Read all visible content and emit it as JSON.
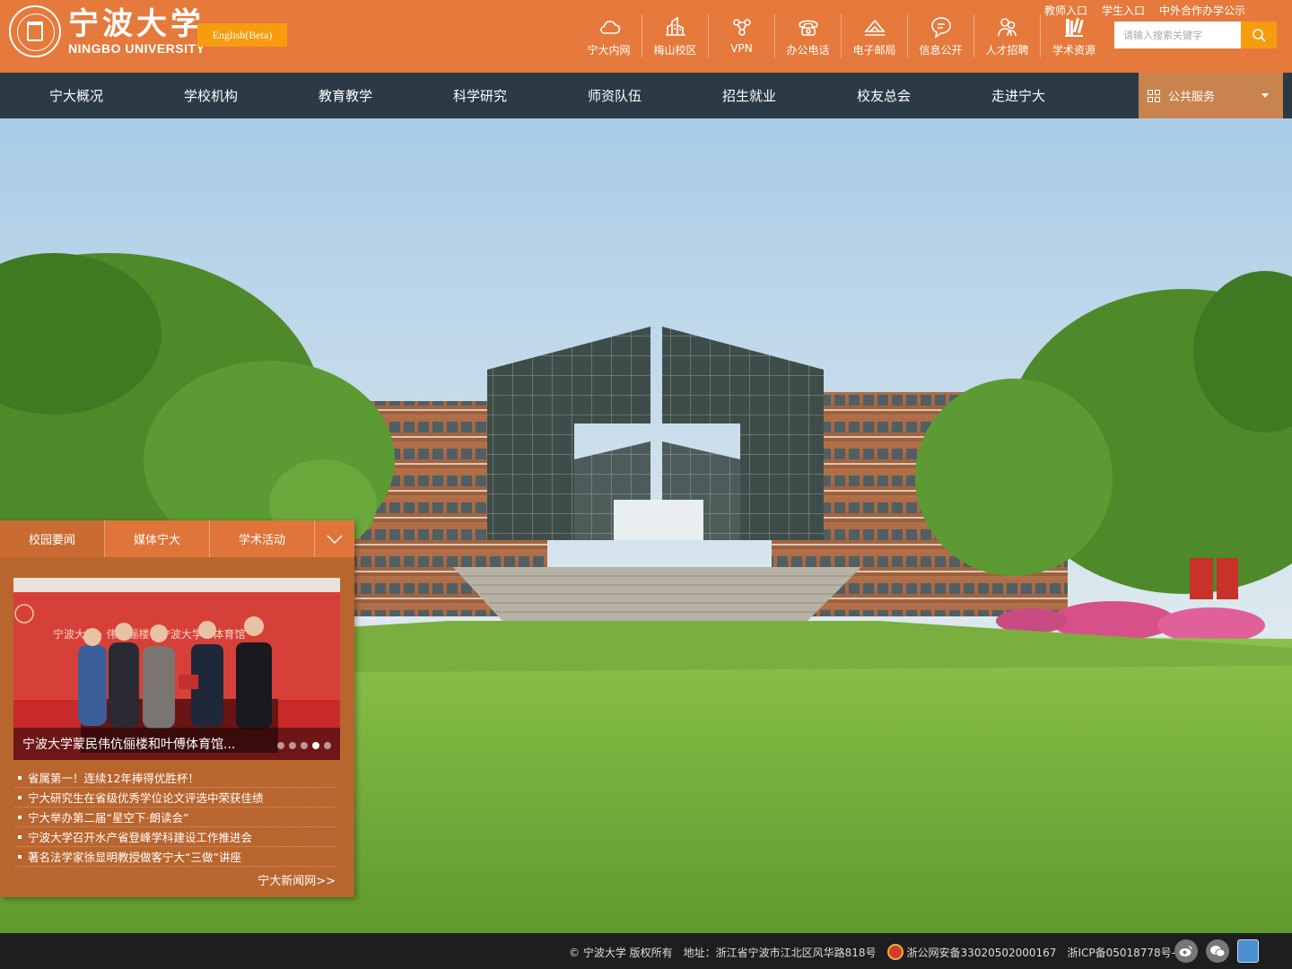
{
  "header": {
    "logo_cn": "宁波大学",
    "logo_en": "NINGBO UNIVERSITY",
    "lang_button": "English(Beta)",
    "quick_links": [
      {
        "label": "宁大内网",
        "icon": "cloud-icon"
      },
      {
        "label": "梅山校区",
        "icon": "campus-building-icon"
      },
      {
        "label": "VPN",
        "icon": "network-nodes-icon"
      },
      {
        "label": "办公电话",
        "icon": "telephone-icon"
      },
      {
        "label": "电子邮局",
        "icon": "mail-send-icon"
      },
      {
        "label": "信息公开",
        "icon": "chat-bubble-icon"
      },
      {
        "label": "人才招聘",
        "icon": "people-icon"
      },
      {
        "label": "学术资源",
        "icon": "books-icon"
      }
    ],
    "top_entries": [
      "教师入口",
      "学生入口",
      "中外合作办学公示"
    ],
    "search": {
      "placeholder": "请输入搜索关键字"
    }
  },
  "nav": {
    "items": [
      "宁大概况",
      "学校机构",
      "教育教学",
      "科学研究",
      "师资队伍",
      "招生就业",
      "校友总会",
      "走进宁大"
    ],
    "public_service": "公共服务"
  },
  "news": {
    "tabs": [
      "校园要闻",
      "媒体宁大",
      "学术活动"
    ],
    "active_tab": 0,
    "slide": {
      "caption": "宁波大学蒙民伟伉俪楼和叶傅体育馆...",
      "banner_text": "宁波大学 · 伟伉俪楼 · 宁波大学 · 体育馆",
      "dot_count": 5,
      "active_dot": 3
    },
    "items": [
      "省属第一！连续12年捧得优胜杯！",
      "宁大研究生在省级优秀学位论文评选中荣获佳绩",
      "宁大举办第二届“星空下·朗读会”",
      "宁波大学召开水产省登峰学科建设工作推进会",
      "著名法学家徐显明教授做客宁大“三做”讲座"
    ],
    "more_link": "宁大新闻网>>"
  },
  "footer": {
    "copyright": "© 宁波大学  版权所有",
    "address": "地址：浙江省宁波市江北区风华路818号",
    "police_record": "浙公网安备33020502000167",
    "icp": "浙ICP备05018778号-1",
    "social": [
      "weibo-icon",
      "wechat-icon",
      "government-badge-icon"
    ]
  },
  "colors": {
    "header_orange": "#e57a3c",
    "nav_dark": "#2b3a44",
    "accent_amber": "#f79b0f",
    "public_service_bg": "#c8834e",
    "news_panel_bg": "#b9652e",
    "footer_bg": "#1e1e1e"
  }
}
